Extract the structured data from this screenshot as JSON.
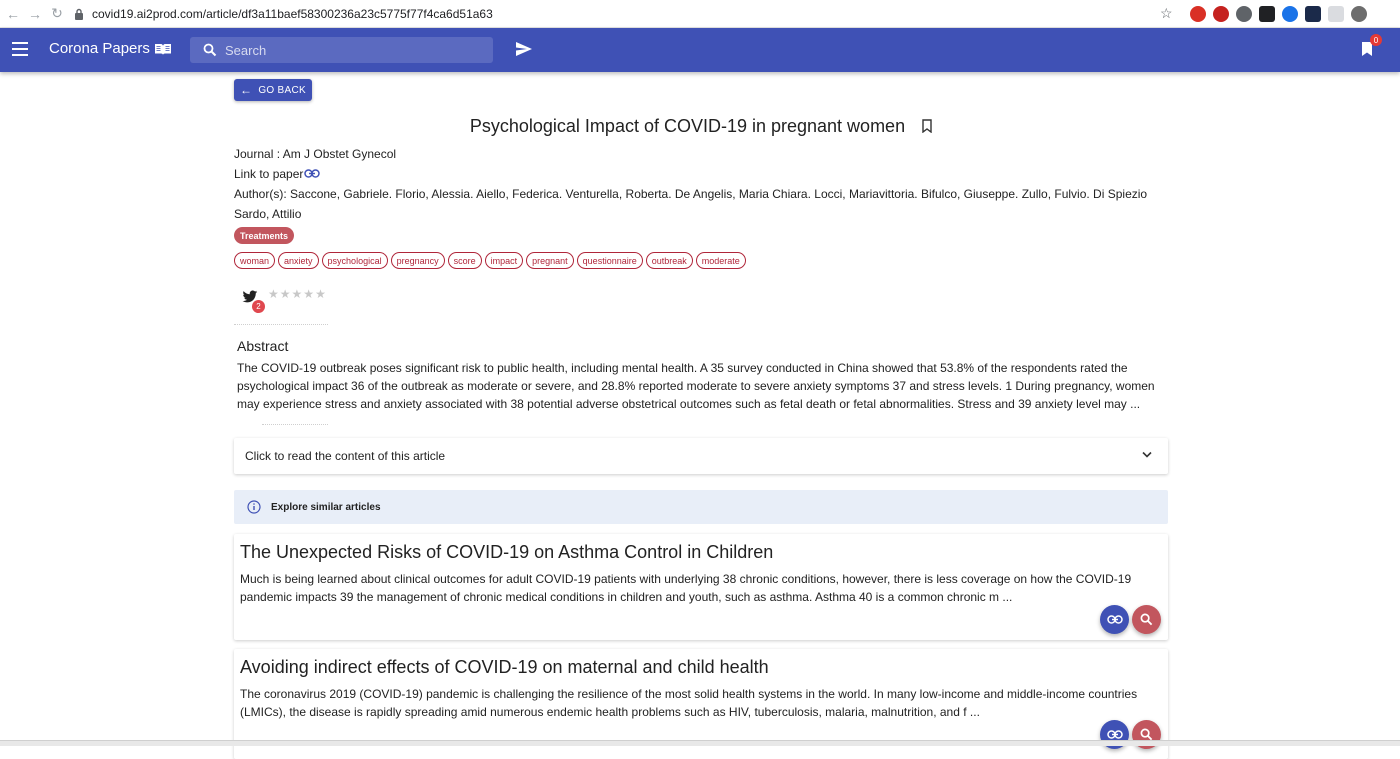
{
  "browser": {
    "url": "covid19.ai2prod.com/article/df3a11baef58300236a23c5775f77f4ca6d51a63"
  },
  "header": {
    "app_title": "Corona Papers",
    "search_placeholder": "Search",
    "bookmark_count": "0"
  },
  "article": {
    "go_back_label": "GO BACK",
    "title": "Psychological Impact of COVID-19 in pregnant women",
    "journal_line": "Journal : Am J Obstet Gynecol",
    "link_label": "Link to paper",
    "authors_line": "Author(s): Saccone, Gabriele. Florio, Alessia. Aiello, Federica. Venturella, Roberta. De Angelis, Maria Chiara. Locci, Mariavittoria. Bifulco, Giuseppe. Zullo, Fulvio. Di Spiezio Sardo, Attilio",
    "category": "Treatments",
    "keywords": [
      "woman",
      "anxiety",
      "psychological",
      "pregnancy",
      "score",
      "impact",
      "pregnant",
      "questionnaire",
      "outbreak",
      "moderate"
    ],
    "tweet_count": "2",
    "rating": {
      "filled": 0,
      "max": 5
    },
    "abstract_heading": "Abstract",
    "abstract_text": "The COVID-19 outbreak poses significant risk to public health, including mental health. A 35 survey conducted in China showed that 53.8% of the respondents rated the psychological impact 36 of the outbreak as moderate or severe, and 28.8% reported moderate to severe anxiety symptoms 37 and stress levels. 1 During pregnancy, women may experience stress and anxiety associated with 38 potential adverse obstetrical outcomes such as fetal death or fetal abnormalities. Stress and 39 anxiety level may ...",
    "expand_label": "Click to read the content of this article"
  },
  "similar": {
    "banner_label": "Explore similar articles",
    "items": [
      {
        "title": "The Unexpected Risks of COVID-19 on Asthma Control in Children",
        "text": "Much is being learned about clinical outcomes for adult COVID-19 patients with underlying 38 chronic conditions, however, there is less coverage on how the COVID-19 pandemic impacts 39 the management of chronic medical conditions in children and youth, such as asthma. Asthma 40 is a common chronic m ..."
      },
      {
        "title": "Avoiding indirect effects of COVID-19 on maternal and child health",
        "text": "The coronavirus 2019 (COVID-19) pandemic is challenging the resilience of the most solid health systems in the world. In many low-income and middle-income countries (LMICs), the disease is rapidly spreading amid numerous endemic health problems such as HIV, tuberculosis, malaria, malnutrition, and f ..."
      }
    ]
  },
  "colors": {
    "primary": "#3f51b5",
    "accent": "#c2565e",
    "keyword": "#b0263a",
    "banner": "#e8eef8"
  },
  "icons": [
    "back-arrow-icon",
    "forward-arrow-icon",
    "reload-icon",
    "lock-icon",
    "star-icon",
    "menu-icon",
    "book-icon",
    "search-icon",
    "send-icon",
    "bookmarks-icon",
    "bookmark-outline-icon",
    "link-icon",
    "twitter-icon",
    "chevron-down-icon",
    "info-icon"
  ]
}
